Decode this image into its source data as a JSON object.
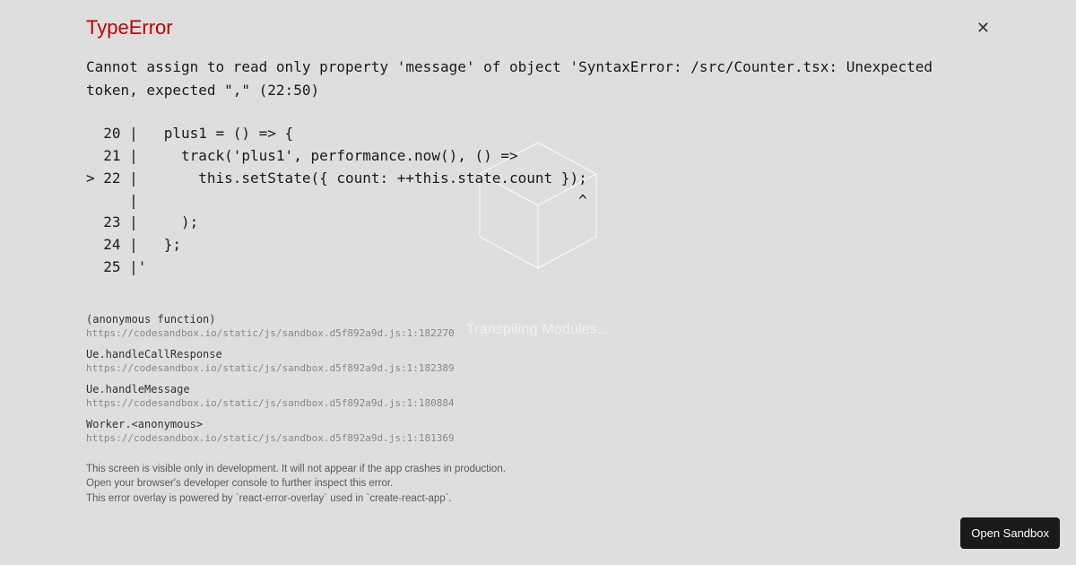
{
  "background": {
    "status_text": "Transpiling Modules..."
  },
  "error": {
    "title": "TypeError",
    "message": "Cannot assign to read only property 'message' of object 'SyntaxError: /src/Counter.tsx: Unexpected token, expected \",\" (22:50)",
    "code_frame": "  20 |   plus1 = () => {\n  21 |     track('plus1', performance.now(), () =>\n> 22 |       this.setState({ count: ++this.state.count });\n     |                                                   ^\n  23 |     );\n  24 |   };\n  25 |'"
  },
  "stack": [
    {
      "fn": "(anonymous function)",
      "loc": "https://codesandbox.io/static/js/sandbox.d5f892a9d.js:1:182270"
    },
    {
      "fn": "Ue.handleCallResponse",
      "loc": "https://codesandbox.io/static/js/sandbox.d5f892a9d.js:1:182389"
    },
    {
      "fn": "Ue.handleMessage",
      "loc": "https://codesandbox.io/static/js/sandbox.d5f892a9d.js:1:180884"
    },
    {
      "fn": "Worker.<anonymous>",
      "loc": "https://codesandbox.io/static/js/sandbox.d5f892a9d.js:1:181369"
    }
  ],
  "footer": {
    "line1": "This screen is visible only in development. It will not appear if the app crashes in production.",
    "line2": "Open your browser's developer console to further inspect this error.",
    "line3": "This error overlay is powered by `react-error-overlay` used in `create-react-app`."
  },
  "buttons": {
    "open_sandbox": "Open Sandbox"
  }
}
